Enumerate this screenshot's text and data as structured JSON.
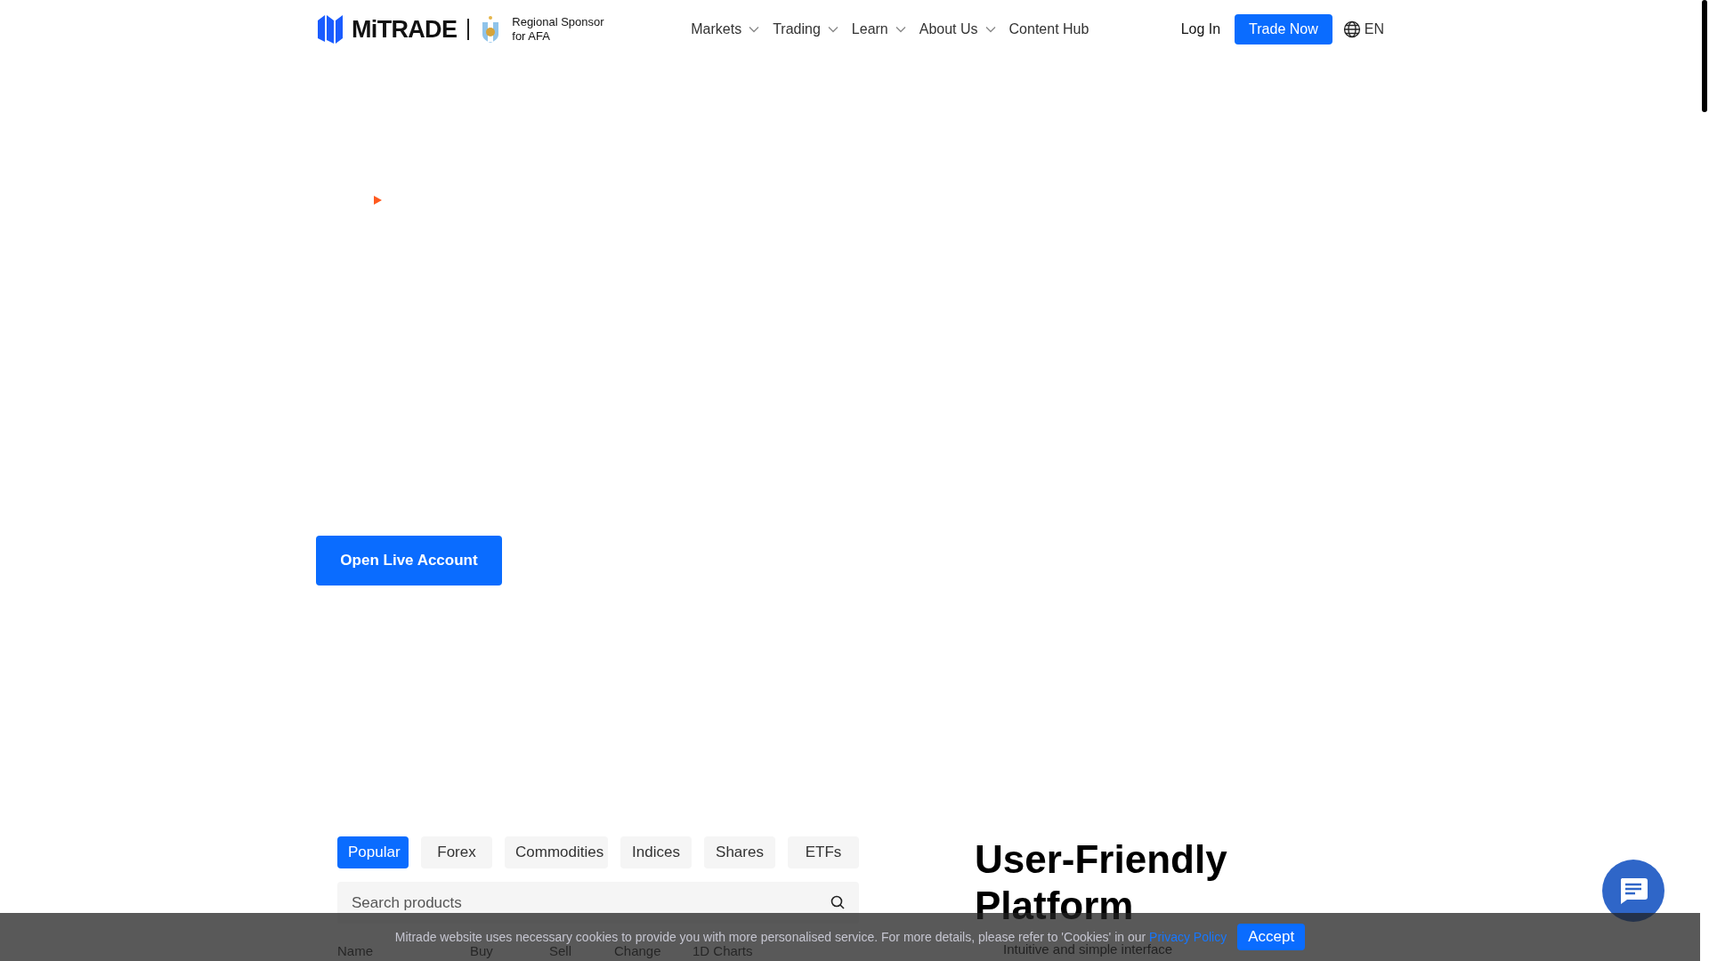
{
  "header": {
    "logo": "MiTRADE",
    "sponsor": "Regional Sponsor for AFA",
    "nav": [
      {
        "label": "Markets",
        "dropdown": true
      },
      {
        "label": "Trading",
        "dropdown": true
      },
      {
        "label": "Learn",
        "dropdown": true
      },
      {
        "label": "About Us",
        "dropdown": true
      },
      {
        "label": "Content Hub",
        "dropdown": false
      }
    ],
    "login": "Log In",
    "cta": "Trade Now",
    "language": "EN"
  },
  "hero": {
    "button": "Open Live Account"
  },
  "products": {
    "tabs": [
      {
        "label": "Popular",
        "selected": true
      },
      {
        "label": "Forex",
        "selected": false
      },
      {
        "label": "Commodities",
        "selected": false
      },
      {
        "label": "Indices",
        "selected": false
      },
      {
        "label": "Shares",
        "selected": false
      },
      {
        "label": "ETFs",
        "selected": false
      }
    ],
    "search": {
      "placeholder": "Search products"
    },
    "columns": [
      "Name",
      "Buy",
      "Sell",
      "Change",
      "1D Charts"
    ]
  },
  "feature": {
    "title": "User-Friendly Platform",
    "item": "Intuitive and simple interface"
  },
  "cookie_bar": {
    "text": "Mitrade website uses necessary cookies to provide you with more personalised service. For more details, please refer to 'Cookies' in our",
    "link": "Privacy Policy",
    "button": "Accept"
  }
}
